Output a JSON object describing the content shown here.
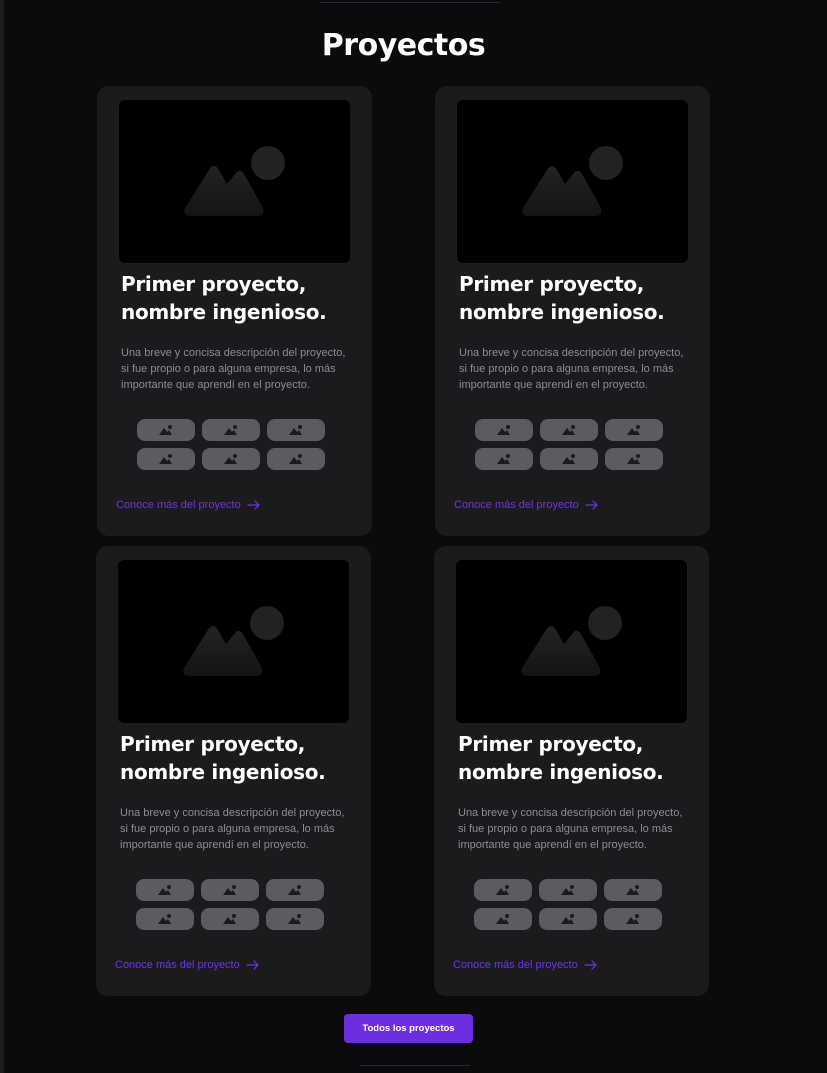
{
  "section": {
    "title": "Proyectos"
  },
  "projects": [
    {
      "title_line1": "Primer proyecto,",
      "title_line2": "nombre ingenioso.",
      "desc_line1": "Una breve y concisa descripción del proyecto,",
      "desc_line2": "si fue propio o para alguna empresa, lo más",
      "desc_line3": "importante que aprendí en el proyecto.",
      "image_icon": "image-placeholder-icon",
      "tech_icons": [
        "image-icon",
        "image-icon",
        "image-icon",
        "image-icon",
        "image-icon",
        "image-icon"
      ],
      "link_label": "Conoce más del proyecto",
      "link_icon": "arrow-right-icon"
    },
    {
      "title_line1": "Primer proyecto,",
      "title_line2": "nombre ingenioso.",
      "desc_line1": "Una breve y concisa descripción del proyecto,",
      "desc_line2": "si fue propio o para alguna empresa, lo más",
      "desc_line3": "importante que aprendí en el proyecto.",
      "image_icon": "image-placeholder-icon",
      "tech_icons": [
        "image-icon",
        "image-icon",
        "image-icon",
        "image-icon",
        "image-icon",
        "image-icon"
      ],
      "link_label": "Conoce más del proyecto",
      "link_icon": "arrow-right-icon"
    },
    {
      "title_line1": "Primer proyecto,",
      "title_line2": "nombre ingenioso.",
      "desc_line1": "Una breve y concisa descripción del proyecto,",
      "desc_line2": "si fue propio o para alguna empresa, lo más",
      "desc_line3": "importante que aprendí en el proyecto.",
      "image_icon": "image-placeholder-icon",
      "tech_icons": [
        "image-icon",
        "image-icon",
        "image-icon",
        "image-icon",
        "image-icon",
        "image-icon"
      ],
      "link_label": "Conoce más del proyecto",
      "link_icon": "arrow-right-icon"
    },
    {
      "title_line1": "Primer proyecto,",
      "title_line2": "nombre ingenioso.",
      "desc_line1": "Una breve y concisa descripción del proyecto,",
      "desc_line2": "si fue propio o para alguna empresa, lo más",
      "desc_line3": "importante que aprendí en el proyecto.",
      "image_icon": "image-placeholder-icon",
      "tech_icons": [
        "image-icon",
        "image-icon",
        "image-icon",
        "image-icon",
        "image-icon",
        "image-icon"
      ],
      "link_label": "Conoce más del proyecto",
      "link_icon": "arrow-right-icon"
    }
  ],
  "footer": {
    "button_label": "Todos los proyectos"
  },
  "colors": {
    "background": "#0b0b0d",
    "card": "#1b1b1e",
    "accent": "#6d2ee0",
    "link": "#6d35e8",
    "chip": "#5c5c60",
    "description": "#8d8d92"
  }
}
